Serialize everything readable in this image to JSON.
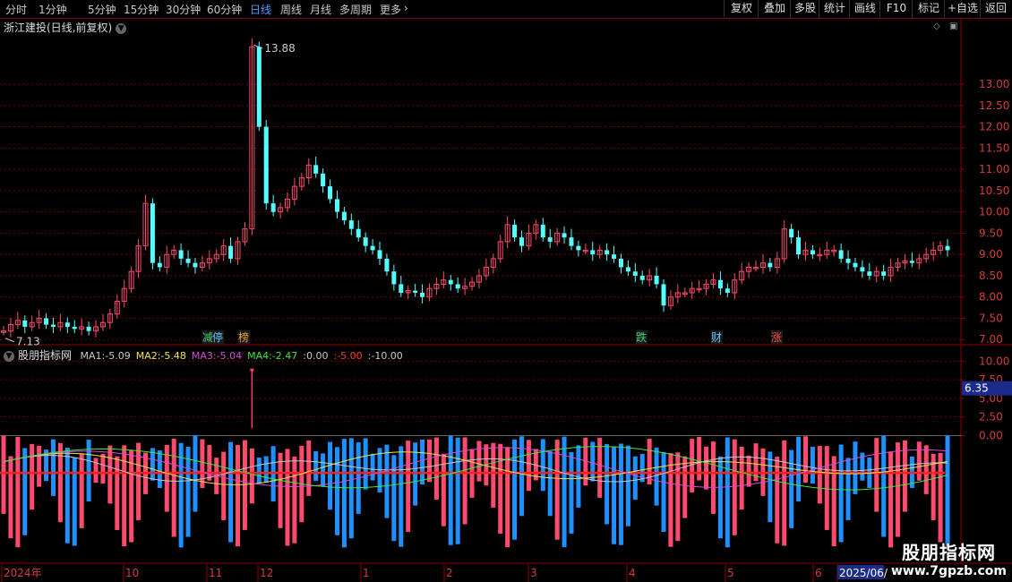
{
  "toolbar": {
    "periods": [
      "分时",
      "1分钟",
      "5分钟",
      "15分钟",
      "30分钟",
      "60分钟",
      "日线",
      "周线",
      "月线",
      "多周期",
      "更多"
    ],
    "active_period": "日线",
    "more_arrow": "›",
    "tools": [
      "复权",
      "叠加",
      "多股",
      "统计",
      "画线",
      "F10",
      "标记",
      "+自选",
      "返回"
    ]
  },
  "main_chart": {
    "title": "浙江建投(日线,前复权)",
    "y_ticks": [
      "13.00",
      "12.50",
      "12.00",
      "11.50",
      "11.00",
      "10.50",
      "10.00",
      "9.50",
      "9.00",
      "8.50",
      "8.00",
      "7.50",
      "7.00"
    ],
    "high_label": "13.88",
    "low_label": "7.13",
    "markers": [
      {
        "text": "减",
        "color": "#3fd17a"
      },
      {
        "text": "停",
        "color": "#62c8ff"
      },
      {
        "text": "榜",
        "color": "#e3a23a"
      },
      {
        "text": "跌",
        "color": "#3fd17a"
      },
      {
        "text": "财",
        "color": "#62c8ff"
      },
      {
        "text": "涨",
        "color": "#ff4a4a"
      }
    ]
  },
  "indicator": {
    "name": "股朋指标网",
    "values": [
      {
        "label": "MA1:",
        "value": "-5.09",
        "color": "#c8c8c8"
      },
      {
        "label": "MA2:",
        "value": "-5.48",
        "color": "#f2e24b"
      },
      {
        "label": "MA3:",
        "value": "-5.04",
        "color": "#d84bd8"
      },
      {
        "label": "MA4:",
        "value": "-2.47",
        "color": "#3ee63e"
      },
      {
        "label": ":",
        "value": "0.00",
        "color": "#c8c8c8"
      },
      {
        "label": ":",
        "value": "-5.00",
        "color": "#ff3a3a"
      },
      {
        "label": ":",
        "value": "-10.00",
        "color": "#c8c8c8"
      }
    ],
    "y_ticks": [
      "10.00",
      "7.50",
      "5.00",
      "2.50",
      "0.00"
    ],
    "current_value": "6.35"
  },
  "x_axis": {
    "labels": [
      "2024年",
      "10",
      "11",
      "12",
      "1",
      "2",
      "3",
      "4",
      "5",
      "6",
      "2025/06/"
    ]
  },
  "watermark": {
    "title": "股朋指标网",
    "url": "www.7gpzb.com"
  },
  "colors": {
    "up": "#ff4a6e",
    "down": "#54ffff",
    "grid": "#8b0000",
    "accent": "#4d9bff"
  },
  "chart_data": [
    {
      "type": "candlestick",
      "title": "浙江建投(日线,前复权)",
      "ylim": [
        6.9,
        14.2
      ],
      "x": [
        "2024年",
        "10",
        "11",
        "12",
        "1",
        "2",
        "3",
        "4",
        "5",
        "6",
        "2025/06/"
      ],
      "close_series": [
        7.2,
        7.35,
        7.45,
        7.3,
        7.4,
        7.5,
        7.35,
        7.3,
        7.4,
        7.3,
        7.25,
        7.3,
        7.2,
        7.3,
        7.4,
        7.6,
        7.9,
        8.2,
        8.6,
        9.2,
        10.2,
        8.8,
        8.7,
        9.0,
        9.1,
        8.9,
        8.8,
        8.7,
        8.8,
        8.9,
        9.0,
        9.2,
        8.9,
        9.3,
        9.6,
        13.88,
        12.0,
        10.2,
        10.0,
        10.1,
        10.3,
        10.6,
        10.8,
        11.1,
        10.9,
        10.6,
        10.3,
        10.0,
        9.8,
        9.6,
        9.4,
        9.2,
        9.1,
        8.9,
        8.6,
        8.3,
        8.1,
        8.15,
        8.1,
        8.0,
        8.2,
        8.3,
        8.4,
        8.3,
        8.2,
        8.25,
        8.35,
        8.5,
        8.7,
        8.9,
        9.3,
        9.7,
        9.4,
        9.2,
        9.5,
        9.7,
        9.4,
        9.3,
        9.5,
        9.4,
        9.2,
        9.1,
        9.1,
        9.0,
        9.1,
        9.0,
        8.9,
        8.7,
        8.6,
        8.5,
        8.4,
        8.5,
        8.3,
        7.8,
        8.0,
        8.1,
        8.1,
        8.2,
        8.2,
        8.3,
        8.4,
        8.2,
        8.1,
        8.4,
        8.6,
        8.7,
        8.7,
        8.8,
        8.7,
        8.9,
        9.6,
        9.4,
        9.0,
        9.1,
        9.0,
        9.0,
        9.1,
        9.1,
        8.9,
        8.8,
        8.7,
        8.6,
        8.5,
        8.6,
        8.5,
        8.7,
        8.8,
        8.85,
        8.8,
        8.9,
        9.0,
        9.1,
        9.2,
        9.1
      ],
      "annotations": [
        {
          "text": "13.88",
          "type": "high"
        },
        {
          "text": "7.13",
          "type": "low"
        }
      ]
    },
    {
      "type": "bar",
      "title": "股朋指标网",
      "ylim": [
        -17,
        11
      ],
      "series": [
        {
          "name": "MA1",
          "value": -5.09
        },
        {
          "name": "MA2",
          "value": -5.48
        },
        {
          "name": "MA3",
          "value": -5.04
        },
        {
          "name": "MA4",
          "value": -2.47
        }
      ],
      "reference_lines": [
        0.0,
        -5.0,
        -10.0
      ],
      "last_value": 6.35
    }
  ]
}
